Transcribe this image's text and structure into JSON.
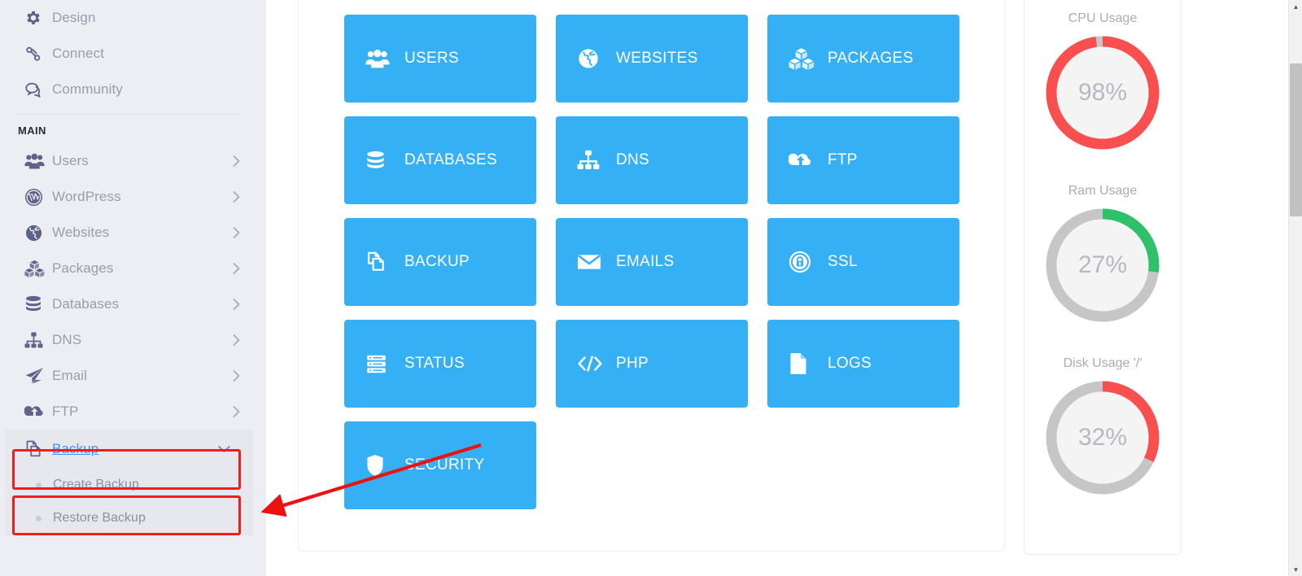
{
  "sidebar": {
    "top_items": [
      {
        "label": "Design",
        "icon": "gear-icon",
        "has_chevron": false
      },
      {
        "label": "Connect",
        "icon": "link-icon",
        "has_chevron": false
      },
      {
        "label": "Community",
        "icon": "chat-icon",
        "has_chevron": false
      }
    ],
    "section_title": "MAIN",
    "main_items": [
      {
        "label": "Users",
        "icon": "users-icon",
        "has_chevron": true
      },
      {
        "label": "WordPress",
        "icon": "wordpress-icon",
        "has_chevron": true
      },
      {
        "label": "Websites",
        "icon": "globe-icon",
        "has_chevron": true
      },
      {
        "label": "Packages",
        "icon": "boxes-icon",
        "has_chevron": true
      },
      {
        "label": "Databases",
        "icon": "database-icon",
        "has_chevron": true
      },
      {
        "label": "DNS",
        "icon": "sitemap-icon",
        "has_chevron": true
      },
      {
        "label": "Email",
        "icon": "paper-plane-icon",
        "has_chevron": true
      },
      {
        "label": "FTP",
        "icon": "cloud-upload-icon",
        "has_chevron": true
      }
    ],
    "backup": {
      "label": "Backup",
      "icon": "copy-icon",
      "expanded": true,
      "chevron": "chevron-down-icon",
      "submenu": [
        {
          "label": "Create Backup",
          "highlighted": true
        },
        {
          "label": "Restore Backup",
          "highlighted": false
        }
      ]
    }
  },
  "main": {
    "tiles": [
      {
        "label": "USERS",
        "icon": "users-icon"
      },
      {
        "label": "WEBSITES",
        "icon": "globe-icon"
      },
      {
        "label": "PACKAGES",
        "icon": "boxes-icon"
      },
      {
        "label": "DATABASES",
        "icon": "database-icon"
      },
      {
        "label": "DNS",
        "icon": "sitemap-icon"
      },
      {
        "label": "FTP",
        "icon": "cloud-upload-icon"
      },
      {
        "label": "BACKUP",
        "icon": "copy-icon"
      },
      {
        "label": "EMAILS",
        "icon": "envelope-icon"
      },
      {
        "label": "SSL",
        "icon": "lock-icon"
      },
      {
        "label": "STATUS",
        "icon": "server-icon"
      },
      {
        "label": "PHP",
        "icon": "code-icon"
      },
      {
        "label": "LOGS",
        "icon": "file-icon"
      },
      {
        "label": "SECURITY",
        "icon": "shield-icon"
      }
    ],
    "tile_color": "#36b0f4"
  },
  "stats": {
    "gauges": [
      {
        "title": "CPU Usage",
        "value": "98%",
        "percent": 98,
        "color": "#f9504f",
        "track": "#c6c6c6"
      },
      {
        "title": "Ram Usage",
        "value": "27%",
        "percent": 27,
        "color": "#2fc169",
        "track": "#c6c6c6"
      },
      {
        "title": "Disk Usage '/'",
        "value": "32%",
        "percent": 32,
        "color": "#f9504f",
        "track": "#c6c6c6"
      }
    ]
  },
  "annotations": {
    "highlight_color": "#f51b1b",
    "arrow_color": "#ee1111",
    "boxes": [
      {
        "target": "Backup"
      },
      {
        "target": "Create Backup"
      }
    ],
    "arrow": {
      "from": "SECURITY tile",
      "to": "Create Backup"
    }
  },
  "scrollbar": {
    "up_glyph": "▲",
    "down_glyph": "▼"
  }
}
